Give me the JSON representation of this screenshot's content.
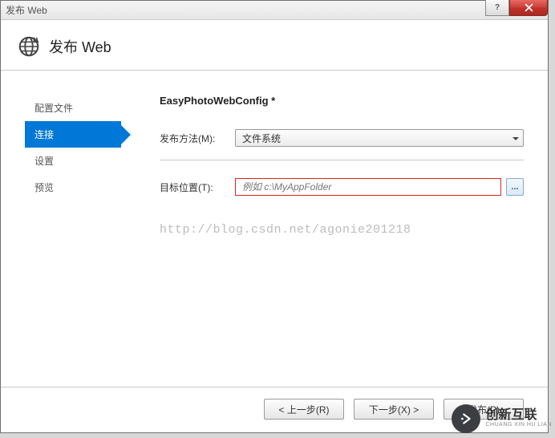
{
  "window": {
    "title": "发布 Web"
  },
  "header": {
    "title": "发布 Web"
  },
  "nav": {
    "items": [
      {
        "label": "配置文件",
        "active": false
      },
      {
        "label": "连接",
        "active": true
      },
      {
        "label": "设置",
        "active": false
      },
      {
        "label": "预览",
        "active": false
      }
    ]
  },
  "main": {
    "config_title": "EasyPhotoWebConfig *",
    "publish_method_label": "发布方法(M):",
    "publish_method_value": "文件系统",
    "target_label": "目标位置(T):",
    "target_placeholder": "例如 c:\\MyAppFolder",
    "browse_label": "...",
    "watermark": "http://blog.csdn.net/agonie201218"
  },
  "footer": {
    "prev": "< 上一步(R)",
    "next": "下一步(X) >",
    "publish": "发布(P)"
  },
  "brand": {
    "cn": "创新互联",
    "en": "CHUANG XIN HU LIAN"
  }
}
